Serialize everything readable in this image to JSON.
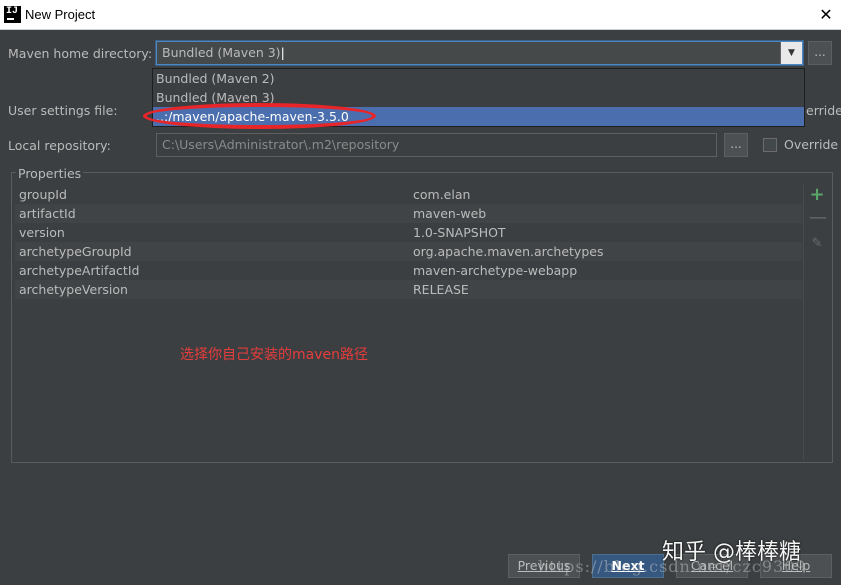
{
  "window": {
    "title": "New Project",
    "close_glyph": "✕"
  },
  "form": {
    "maven_home_label": "Maven home directory:",
    "maven_home_value": "Bundled (Maven 3)",
    "combo_arrow_glyph": "▼",
    "browse_label": "...",
    "user_settings_label": "User settings file:",
    "user_settings_override_label": "erride",
    "local_repo_label": "Local repository:",
    "local_repo_value": "C:\\Users\\Administrator\\.m2\\repository",
    "local_repo_override_label": "Override"
  },
  "dropdown": {
    "items": [
      {
        "label": "Bundled (Maven 2)",
        "selected": false
      },
      {
        "label": "Bundled (Maven 3)",
        "selected": false
      },
      {
        "label": "..:/maven/apache-maven-3.5.0",
        "selected": true
      }
    ]
  },
  "properties": {
    "title": "Properties",
    "rows": [
      {
        "key": "groupId",
        "value": "com.elan"
      },
      {
        "key": "artifactId",
        "value": "maven-web"
      },
      {
        "key": "version",
        "value": "1.0-SNAPSHOT"
      },
      {
        "key": "archetypeGroupId",
        "value": "org.apache.maven.archetypes"
      },
      {
        "key": "archetypeArtifactId",
        "value": "maven-archetype-webapp"
      },
      {
        "key": "archetypeVersion",
        "value": "RELEASE"
      }
    ],
    "toolbar": {
      "add": "+",
      "remove": "—",
      "edit": "✎"
    }
  },
  "annotation": {
    "note": "选择你自己安装的maven路径",
    "color": "#e63c3c"
  },
  "buttons": {
    "previous": "Previous",
    "next": "Next",
    "cancel": "Cancel",
    "help": "Help"
  },
  "watermark": {
    "zhihu": "知乎 @棒棒糖",
    "url": "https://blog.csdn.net/czc9309"
  },
  "colors": {
    "background": "#3c3f41",
    "selection": "#4b6eaf",
    "focus_border": "#4a88c7",
    "add_icon": "#59a869"
  }
}
